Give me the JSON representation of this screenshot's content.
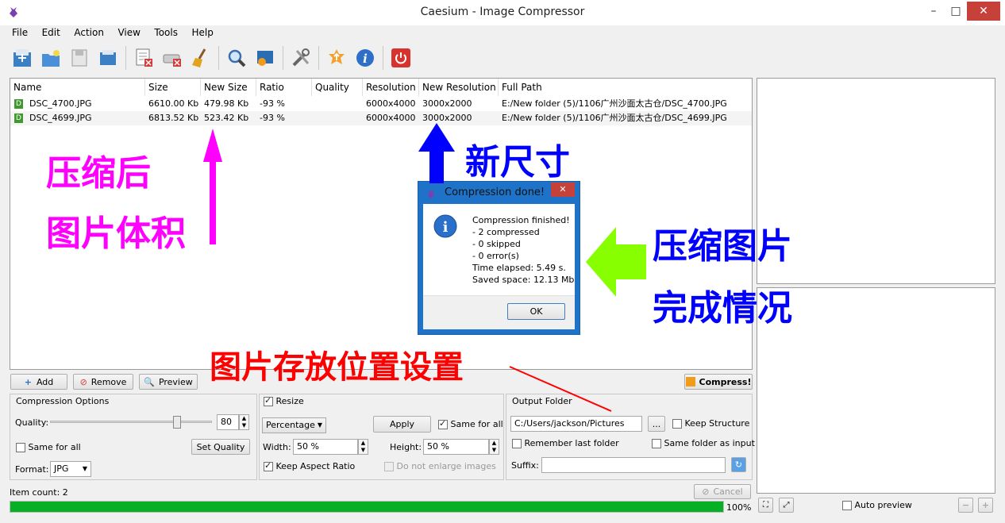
{
  "window": {
    "title": "Caesium - Image Compressor",
    "min": "–",
    "max": "□",
    "close": "✕"
  },
  "menu": [
    "File",
    "Edit",
    "Action",
    "View",
    "Tools",
    "Help"
  ],
  "table": {
    "columns": [
      "Name",
      "Size",
      "New Size",
      "Ratio",
      "Quality",
      "Resolution",
      "New Resolution",
      "Full Path"
    ],
    "rows": [
      [
        "DSC_4700.JPG",
        "6610.00 Kb",
        "479.98 Kb",
        "-93 %",
        "",
        "6000x4000",
        "3000x2000",
        "E:/New folder (5)/1106广州沙面太古仓/DSC_4700.JPG"
      ],
      [
        "DSC_4699.JPG",
        "6813.52 Kb",
        "523.42 Kb",
        "-93 %",
        "",
        "6000x4000",
        "3000x2000",
        "E:/New folder (5)/1106广州沙面太古仓/DSC_4699.JPG"
      ]
    ]
  },
  "buttons": {
    "add": "Add",
    "remove": "Remove",
    "preview": "Preview",
    "compress": "Compress!",
    "cancel": "Cancel"
  },
  "compression": {
    "title": "Compression Options",
    "quality_label": "Quality:",
    "quality_value": "80",
    "quality_level": 0.8,
    "same_for_all": "Same for all",
    "set_quality": "Set Quality",
    "format_label": "Format:",
    "format_value": "JPG"
  },
  "resize": {
    "title": "Resize",
    "mode": "Percentage",
    "apply": "Apply",
    "same_for_all": "Same for all",
    "width_label": "Width:",
    "width_value": "50 %",
    "height_label": "Height:",
    "height_value": "50 %",
    "keep_aspect": "Keep Aspect Ratio",
    "no_enlarge": "Do not enlarge images"
  },
  "output": {
    "title": "Output Folder",
    "path": "C:/Users/jackson/Pictures",
    "browse": "...",
    "keep_structure": "Keep Structure",
    "remember": "Remember last folder",
    "same_folder": "Same folder as input",
    "suffix_label": "Suffix:",
    "suffix_value": ""
  },
  "status": {
    "item_count": "Item count: 2",
    "progress": 1.0,
    "progress_text": "100%"
  },
  "preview_bar": {
    "auto_preview": "Auto preview"
  },
  "dialog": {
    "title": "Compression done!",
    "close": "✕",
    "lines": [
      "Compression finished!",
      "- 2 compressed",
      "- 0 skipped",
      "- 0 error(s)",
      "Time elapsed: 5.49 s.",
      "Saved space: 12.13 Mb"
    ],
    "ok": "OK"
  },
  "annotations": {
    "compressed_size_1": "压缩后",
    "compressed_size_2": "图片体积",
    "new_size": "新尺寸",
    "done_1": "压缩图片",
    "done_2": "完成情况",
    "output_setting": "图片存放位置设置"
  },
  "colors": {
    "magenta": "#ff00ff",
    "blue": "#0000ff",
    "green": "#88ff00",
    "red": "#ff0000",
    "progress": "#06b025"
  }
}
